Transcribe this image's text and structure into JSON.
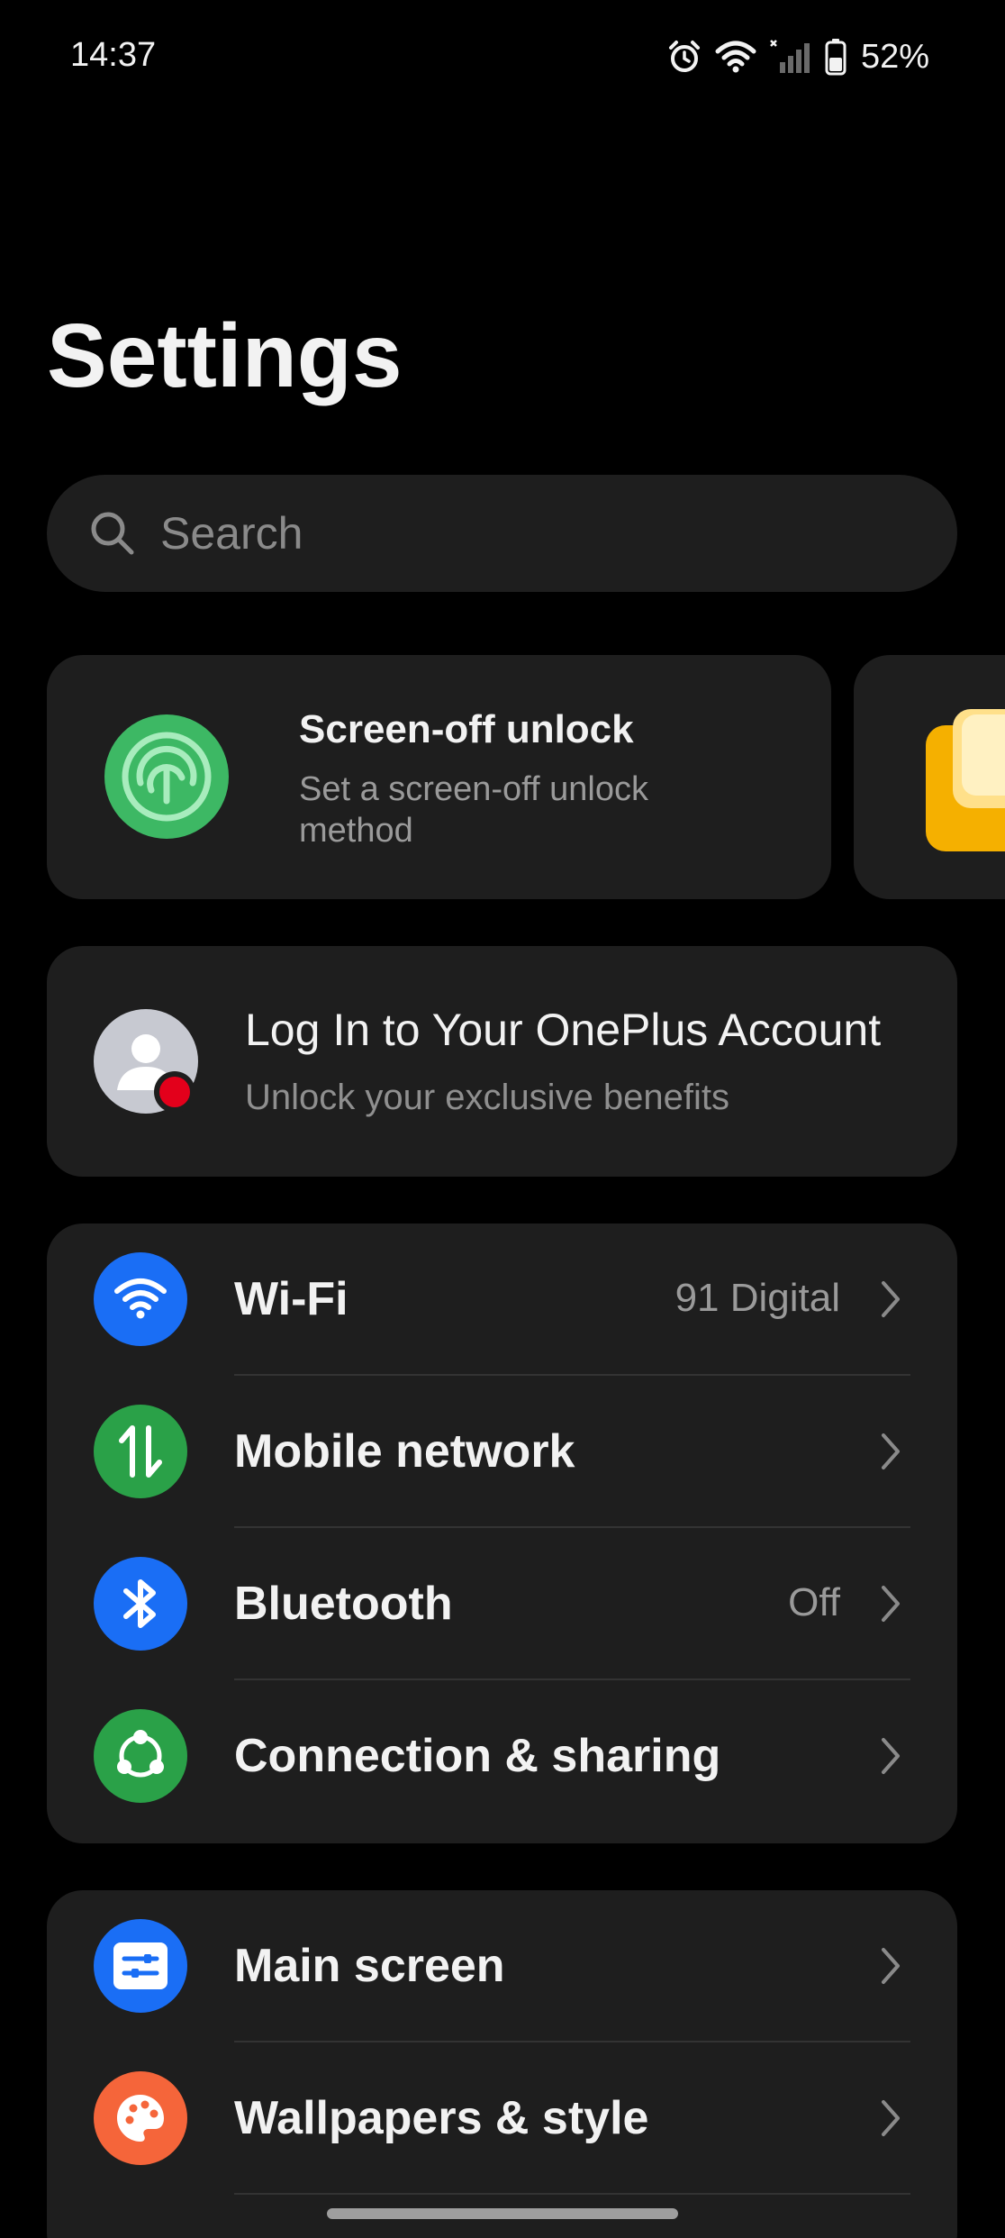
{
  "status_bar": {
    "time": "14:37",
    "battery_percent": "52%",
    "battery_level": 0.52,
    "icons": [
      "alarm-icon",
      "wifi-icon",
      "signal-icon",
      "battery-icon"
    ]
  },
  "page": {
    "title": "Settings"
  },
  "search": {
    "placeholder": "Search"
  },
  "suggestions": [
    {
      "title": "Screen-off unlock",
      "subtitle": "Set a screen-off unlock method",
      "icon": "fingerprint-icon",
      "icon_color": "#3db864"
    },
    {
      "title": "",
      "subtitle": "",
      "icon": "notes-icon",
      "icon_color": "#f5b000"
    }
  ],
  "account": {
    "title": "Log In to Your OnePlus Account",
    "subtitle": "Unlock your exclusive benefits",
    "badge_color": "#e3001b"
  },
  "groups": [
    {
      "items": [
        {
          "label": "Wi-Fi",
          "value": "91 Digital",
          "icon": "wifi-icon",
          "color": "#1a6ef5"
        },
        {
          "label": "Mobile network",
          "value": "",
          "icon": "mobile-data-icon",
          "color": "#2aa148"
        },
        {
          "label": "Bluetooth",
          "value": "Off",
          "icon": "bluetooth-icon",
          "color": "#1a6ef5"
        },
        {
          "label": "Connection & sharing",
          "value": "",
          "icon": "share-icon",
          "color": "#2aa148"
        }
      ]
    },
    {
      "items": [
        {
          "label": "Main screen",
          "value": "",
          "icon": "main-screen-icon",
          "color": "#1a6ef5"
        },
        {
          "label": "Wallpapers & style",
          "value": "",
          "icon": "palette-icon",
          "color": "#f5653a"
        }
      ]
    }
  ]
}
